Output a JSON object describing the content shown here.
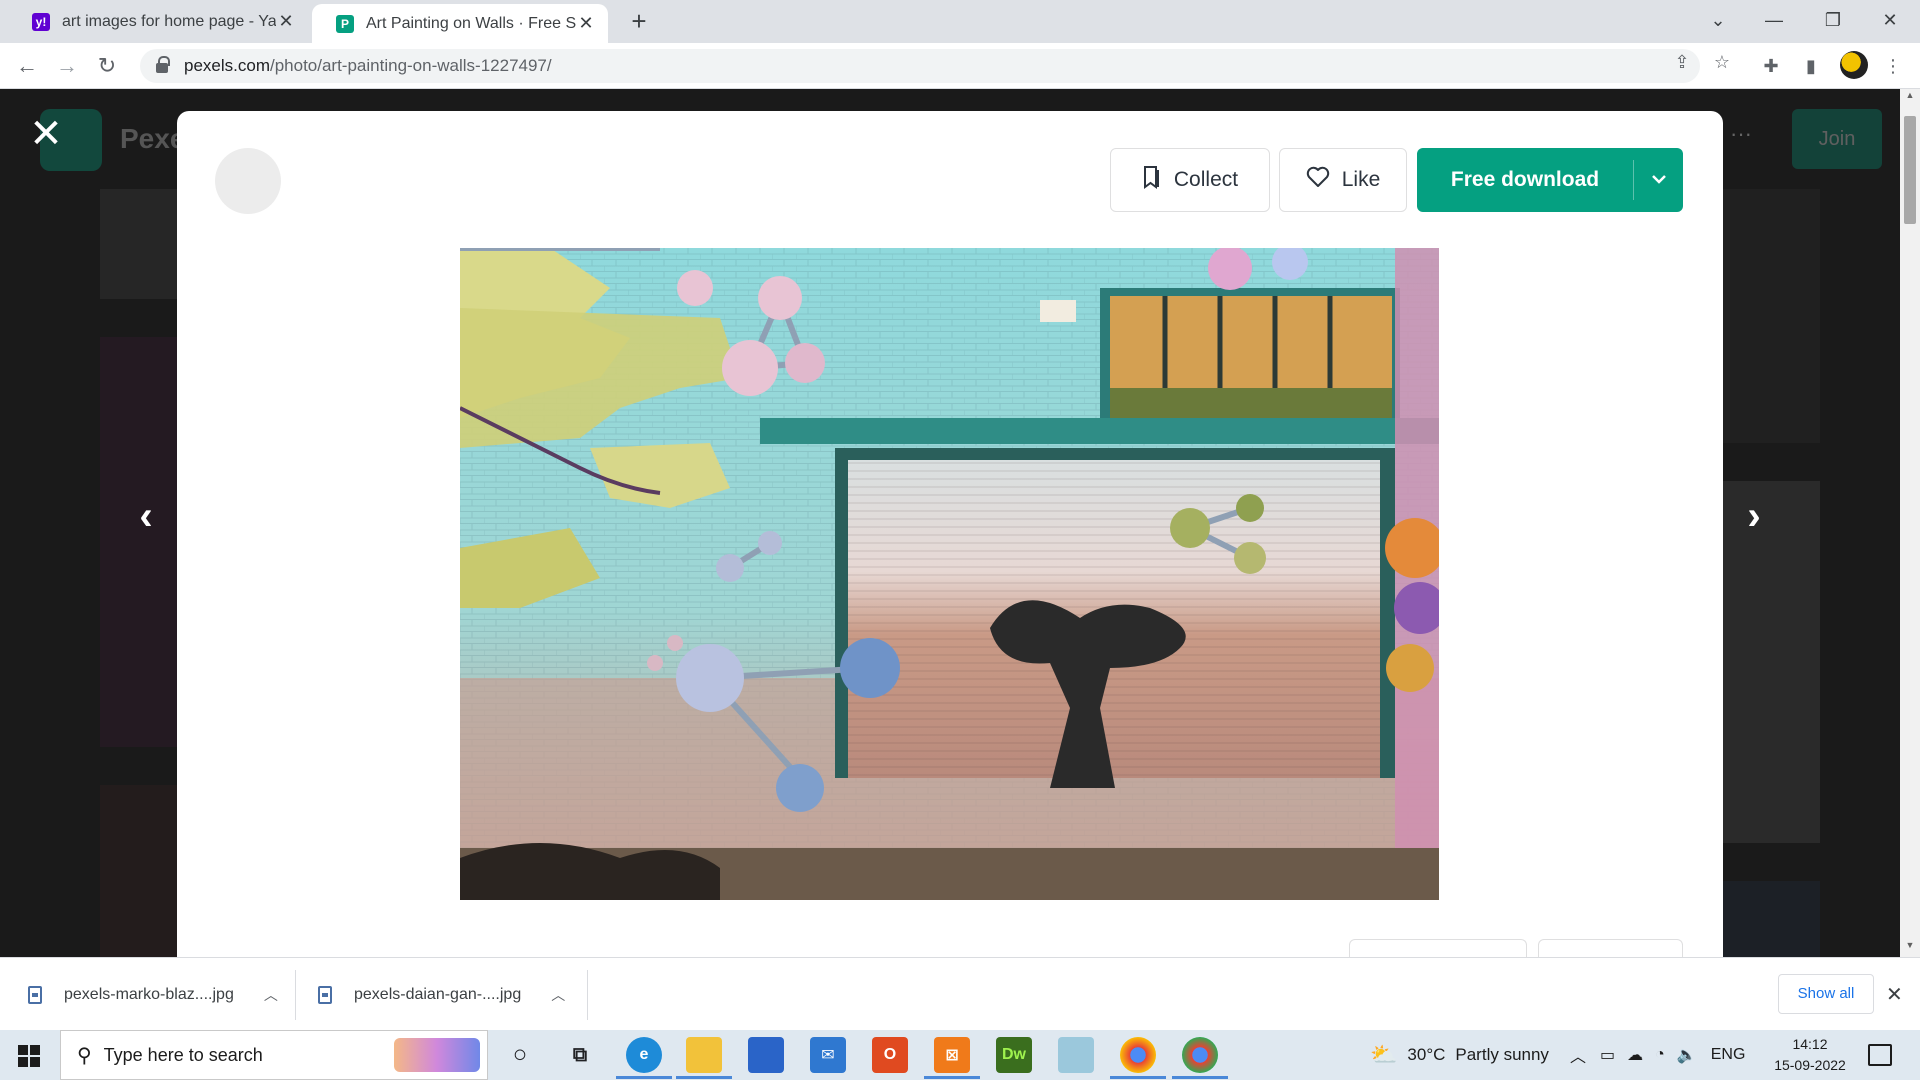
{
  "browser": {
    "tabs": [
      {
        "title": "art images for home page - Yaho",
        "active": false,
        "favicon": "yahoo-icon"
      },
      {
        "title": "Art Painting on Walls · Free Stock",
        "active": true,
        "favicon": "pexels-icon"
      }
    ],
    "new_tab": "+",
    "url_host": "pexels.com",
    "url_path": "/photo/art-painting-on-walls-1227497/"
  },
  "page_behind": {
    "brand_partial": "Pexe",
    "join_label": "Join"
  },
  "modal": {
    "collect_label": "Collect",
    "like_label": "Like",
    "download_label": "Free download"
  },
  "downloads": [
    {
      "name": "pexels-marko-blaz....jpg"
    },
    {
      "name": "pexels-daian-gan-....jpg"
    }
  ],
  "downloads_show_all": "Show all",
  "taskbar": {
    "search_placeholder": "Type here to search",
    "weather_temp": "30°C",
    "weather_desc": "Partly sunny",
    "language": "ENG",
    "time": "14:12",
    "date": "15-09-2022"
  },
  "colors": {
    "brand_green": "#05a081",
    "chrome_tab_bar": "#dee1e6"
  }
}
